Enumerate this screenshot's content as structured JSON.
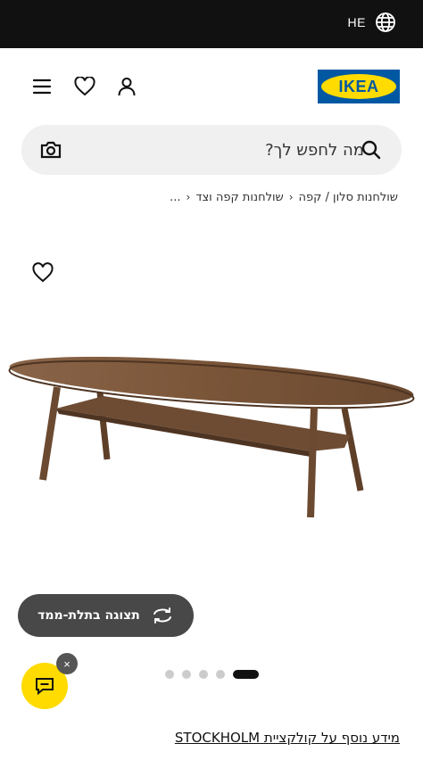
{
  "topbar": {
    "language_code": "HE"
  },
  "header": {
    "logo_text": "IKEA"
  },
  "search": {
    "placeholder": "מה לחפש לך?"
  },
  "breadcrumb": {
    "overflow": "...",
    "items": [
      "שולחנות קפה וצד",
      "שולחנות סלון / קפה"
    ]
  },
  "gallery": {
    "view_3d_label": "תצוגה בתלת-ממד",
    "dot_count": 5,
    "active_index": 0
  },
  "chat": {
    "close_label": "×"
  },
  "collection": {
    "link_text": "מידע נוסף על קולקציית STOCKHOLM"
  },
  "colors": {
    "topbar": "#111111",
    "ikea_blue": "#0058a3",
    "ikea_yellow": "#ffdb00",
    "search_bg": "#f0f0f0",
    "button_dark": "#484848"
  }
}
